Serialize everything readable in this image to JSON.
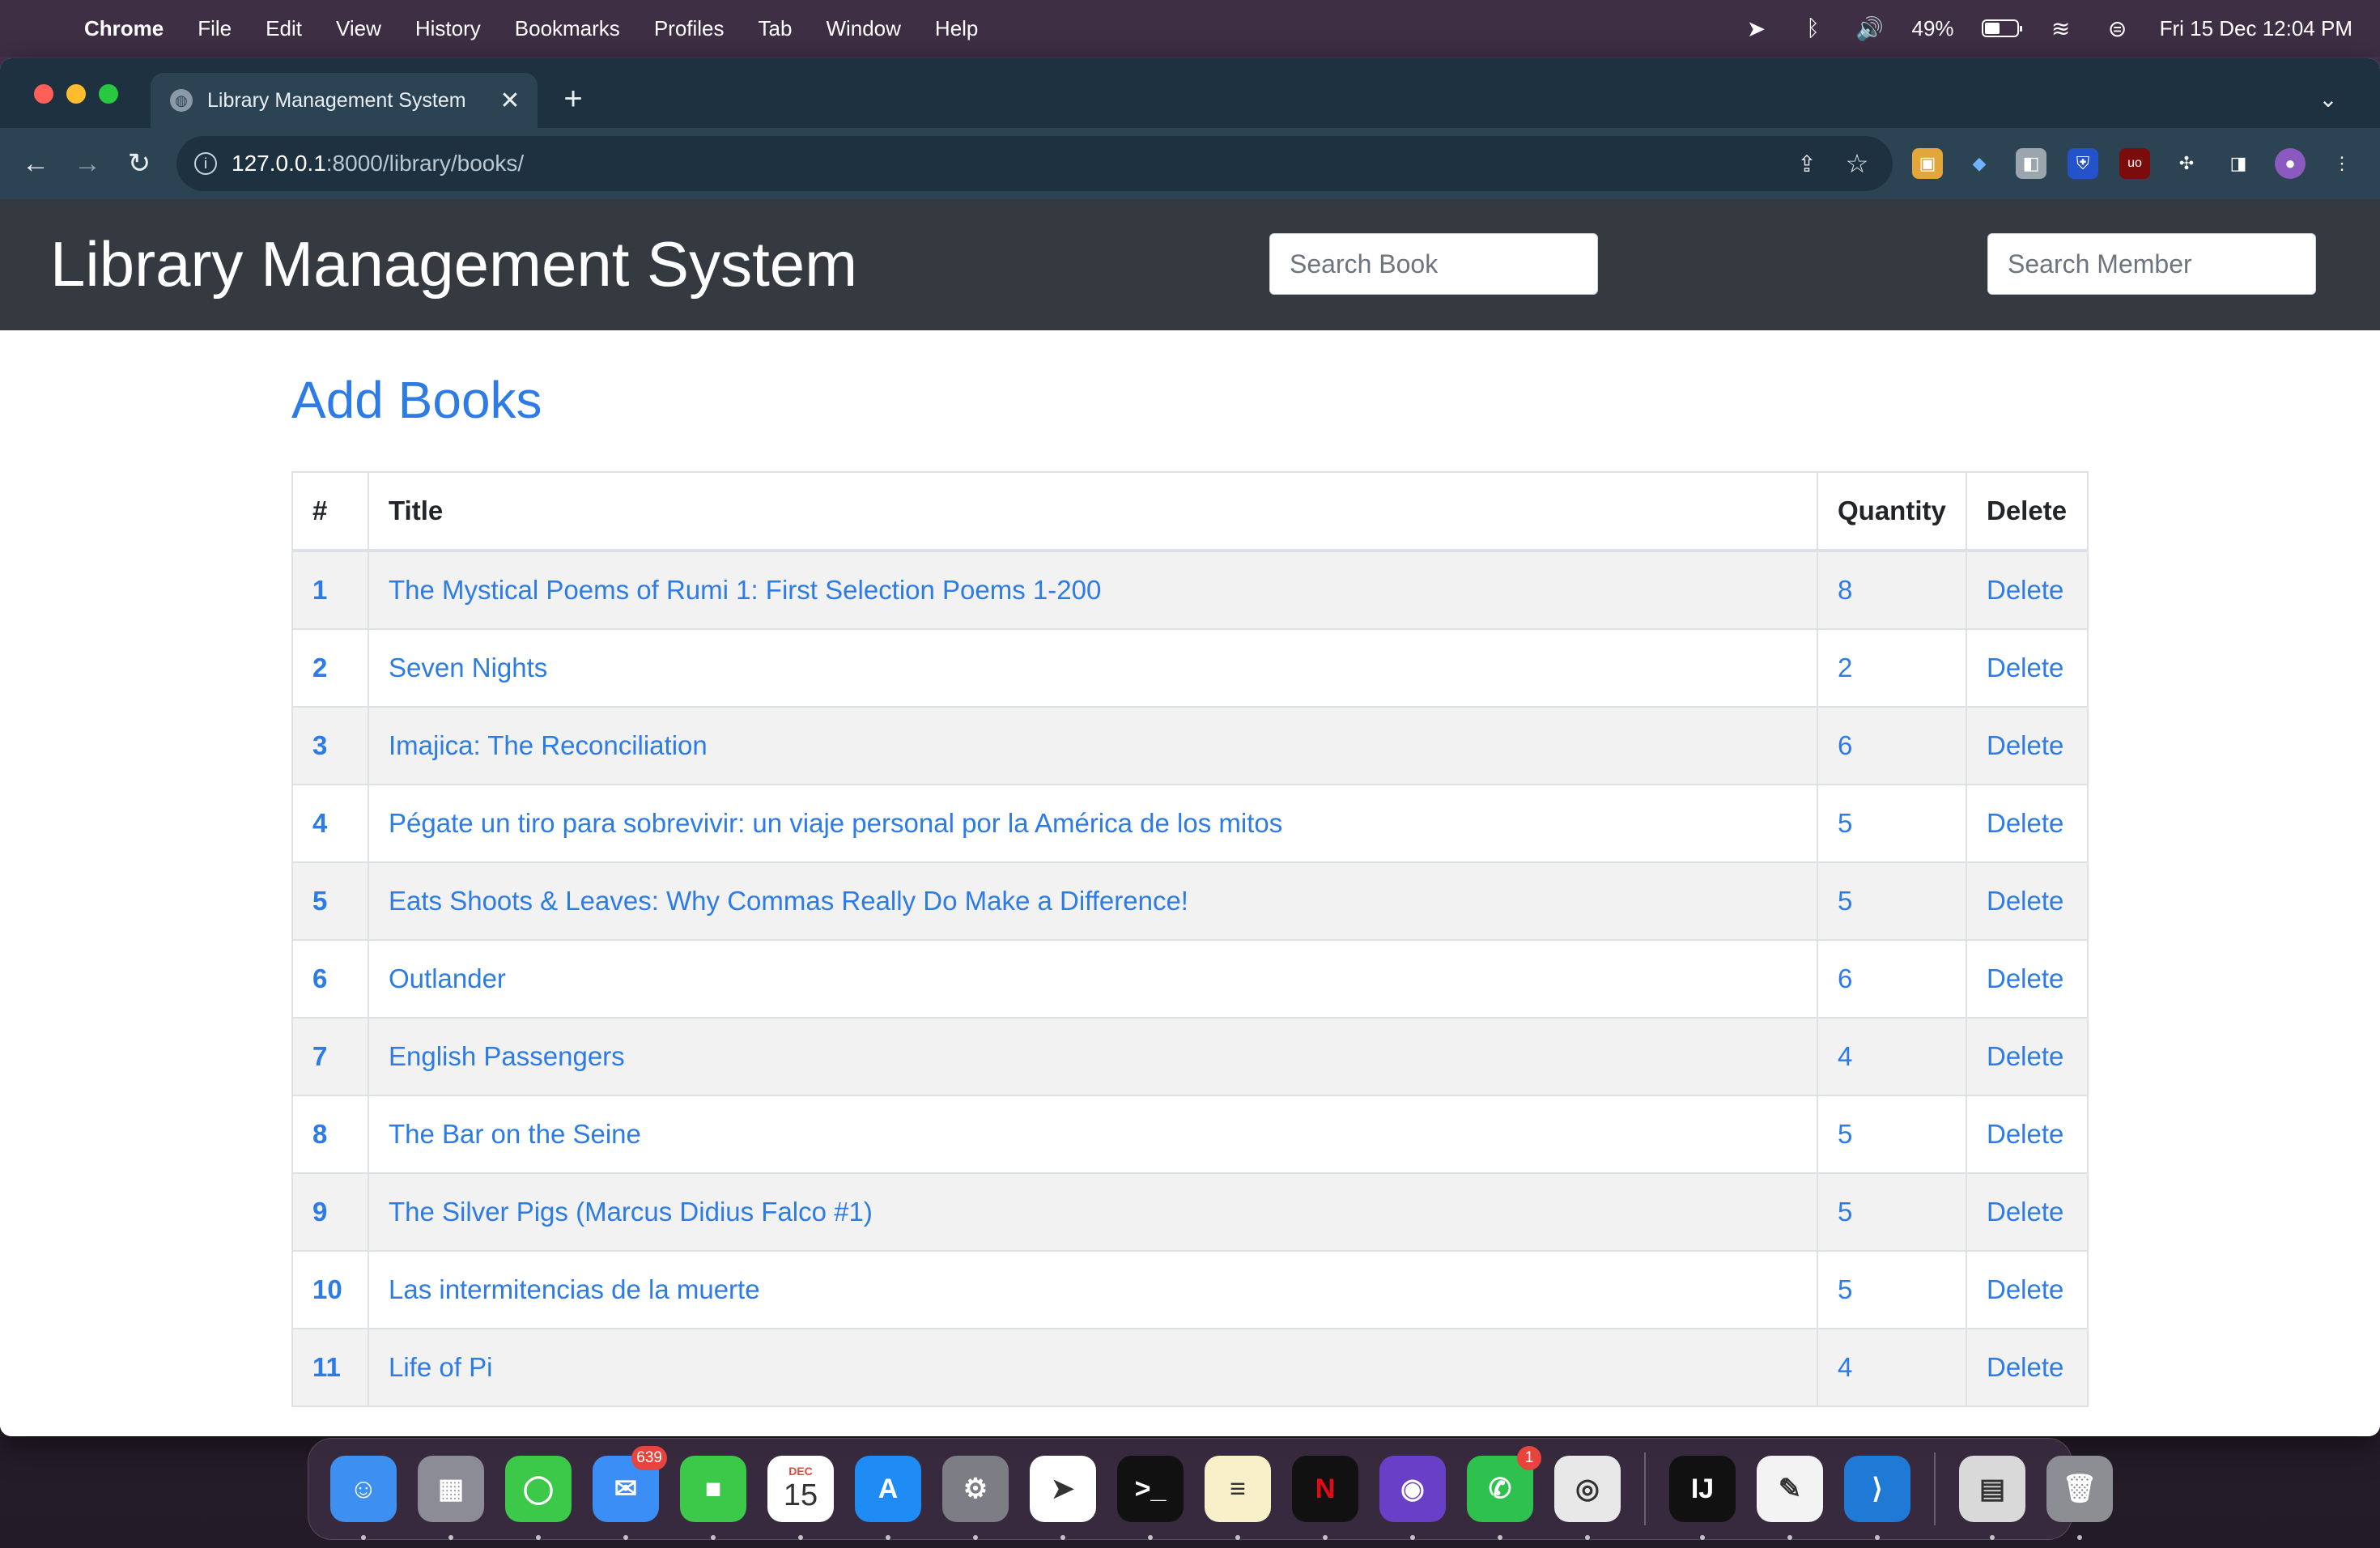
{
  "menubar": {
    "app_name": "Chrome",
    "items": [
      "File",
      "Edit",
      "View",
      "History",
      "Bookmarks",
      "Profiles",
      "Tab",
      "Window",
      "Help"
    ],
    "battery_percent": "49%",
    "battery_level": 0.49,
    "datetime": "Fri 15 Dec  12:04 PM"
  },
  "browser": {
    "tab_title": "Library Management System",
    "url_host": "127.0.0.1",
    "url_path": ":8000/library/books/"
  },
  "page": {
    "brand": "Library Management System",
    "search_book_placeholder": "Search Book",
    "search_member_placeholder": "Search Member",
    "heading": "Add Books",
    "table": {
      "headers": [
        "#",
        "Title",
        "Quantity",
        "Delete"
      ],
      "rows": [
        {
          "num": "1",
          "title": "The Mystical Poems of Rumi 1: First Selection Poems 1-200",
          "qty": "8",
          "action": "Delete"
        },
        {
          "num": "2",
          "title": "Seven Nights",
          "qty": "2",
          "action": "Delete"
        },
        {
          "num": "3",
          "title": "Imajica: The Reconciliation",
          "qty": "6",
          "action": "Delete"
        },
        {
          "num": "4",
          "title": "Pégate un tiro para sobrevivir: un viaje personal por la América de los mitos",
          "qty": "5",
          "action": "Delete"
        },
        {
          "num": "5",
          "title": "Eats Shoots & Leaves: Why Commas Really Do Make a Difference!",
          "qty": "5",
          "action": "Delete"
        },
        {
          "num": "6",
          "title": "Outlander",
          "qty": "6",
          "action": "Delete"
        },
        {
          "num": "7",
          "title": "English Passengers",
          "qty": "4",
          "action": "Delete"
        },
        {
          "num": "8",
          "title": "The Bar on the Seine",
          "qty": "5",
          "action": "Delete"
        },
        {
          "num": "9",
          "title": "The Silver Pigs (Marcus Didius Falco #1)",
          "qty": "5",
          "action": "Delete"
        },
        {
          "num": "10",
          "title": "Las intermitencias de la muerte",
          "qty": "5",
          "action": "Delete"
        },
        {
          "num": "11",
          "title": "Life of Pi",
          "qty": "4",
          "action": "Delete"
        }
      ]
    }
  },
  "dock": {
    "apps": [
      {
        "name": "finder",
        "color": "#3d8ff0",
        "glyph": "☺"
      },
      {
        "name": "launchpad",
        "color": "#8c8c96",
        "glyph": "▦"
      },
      {
        "name": "messages",
        "color": "#3cc94a",
        "glyph": "◯"
      },
      {
        "name": "mail",
        "color": "#3a8ef5",
        "glyph": "✉",
        "badge": "639"
      },
      {
        "name": "facetime",
        "color": "#3cc94a",
        "glyph": "■"
      },
      {
        "name": "calendar",
        "color": "#ffffff",
        "glyph": "15",
        "month": "DEC"
      },
      {
        "name": "app-store",
        "color": "#1f8cf5",
        "glyph": "A"
      },
      {
        "name": "system-settings",
        "color": "#7d7d85",
        "glyph": "⚙"
      },
      {
        "name": "telegram",
        "color": "#ffffff",
        "glyph": "➤"
      },
      {
        "name": "terminal",
        "color": "#111111",
        "glyph": ">_"
      },
      {
        "name": "notes",
        "color": "#f7f0c8",
        "glyph": "≡"
      },
      {
        "name": "netflix",
        "color": "#111111",
        "glyph": "N"
      },
      {
        "name": "firefox",
        "color": "#6a3fc8",
        "glyph": "◉"
      },
      {
        "name": "whatsapp",
        "color": "#2fc14e",
        "glyph": "✆",
        "badge": "1"
      },
      {
        "name": "chrome",
        "color": "#e8e8e8",
        "glyph": "◎"
      },
      {
        "name": "intellij-idea",
        "color": "#111111",
        "glyph": "IJ"
      },
      {
        "name": "textedit",
        "color": "#f3f3f3",
        "glyph": "✎"
      },
      {
        "name": "vscode",
        "color": "#1f7ad6",
        "glyph": "⟩"
      },
      {
        "name": "preview-document",
        "color": "#d9d9d9",
        "glyph": "▤"
      },
      {
        "name": "trash",
        "color": "#8d8d94",
        "glyph": "🗑"
      }
    ]
  }
}
